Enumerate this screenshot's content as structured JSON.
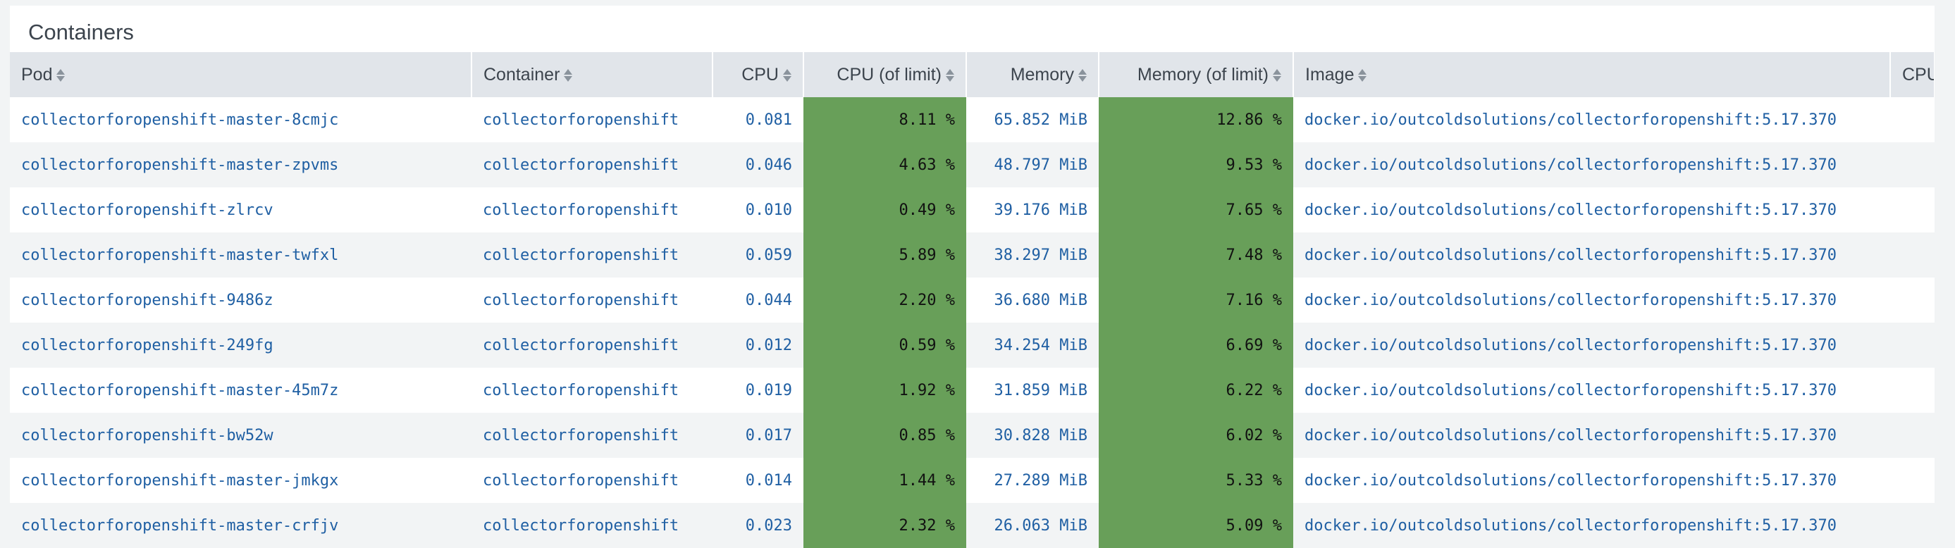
{
  "panel": {
    "title": "Containers"
  },
  "colors": {
    "highlight": "#689f59",
    "link": "#1f5fa3",
    "header_bg": "#e1e5ea"
  },
  "columns": [
    "Pod",
    "Container",
    "CPU",
    "CPU (of limit)",
    "Memory",
    "Memory (of limit)",
    "Image",
    "CPU"
  ],
  "rows": [
    {
      "pod": "collectorforopenshift-master-8cmjc",
      "container": "collectorforopenshift",
      "cpu": "0.081",
      "cpu_limit": "8.11 %",
      "memory": "65.852 MiB",
      "memory_limit": "12.86 %",
      "image": "docker.io/outcoldsolutions/collectorforopenshift:5.17.370"
    },
    {
      "pod": "collectorforopenshift-master-zpvms",
      "container": "collectorforopenshift",
      "cpu": "0.046",
      "cpu_limit": "4.63 %",
      "memory": "48.797 MiB",
      "memory_limit": "9.53 %",
      "image": "docker.io/outcoldsolutions/collectorforopenshift:5.17.370"
    },
    {
      "pod": "collectorforopenshift-zlrcv",
      "container": "collectorforopenshift",
      "cpu": "0.010",
      "cpu_limit": "0.49 %",
      "memory": "39.176 MiB",
      "memory_limit": "7.65 %",
      "image": "docker.io/outcoldsolutions/collectorforopenshift:5.17.370"
    },
    {
      "pod": "collectorforopenshift-master-twfxl",
      "container": "collectorforopenshift",
      "cpu": "0.059",
      "cpu_limit": "5.89 %",
      "memory": "38.297 MiB",
      "memory_limit": "7.48 %",
      "image": "docker.io/outcoldsolutions/collectorforopenshift:5.17.370"
    },
    {
      "pod": "collectorforopenshift-9486z",
      "container": "collectorforopenshift",
      "cpu": "0.044",
      "cpu_limit": "2.20 %",
      "memory": "36.680 MiB",
      "memory_limit": "7.16 %",
      "image": "docker.io/outcoldsolutions/collectorforopenshift:5.17.370"
    },
    {
      "pod": "collectorforopenshift-249fg",
      "container": "collectorforopenshift",
      "cpu": "0.012",
      "cpu_limit": "0.59 %",
      "memory": "34.254 MiB",
      "memory_limit": "6.69 %",
      "image": "docker.io/outcoldsolutions/collectorforopenshift:5.17.370"
    },
    {
      "pod": "collectorforopenshift-master-45m7z",
      "container": "collectorforopenshift",
      "cpu": "0.019",
      "cpu_limit": "1.92 %",
      "memory": "31.859 MiB",
      "memory_limit": "6.22 %",
      "image": "docker.io/outcoldsolutions/collectorforopenshift:5.17.370"
    },
    {
      "pod": "collectorforopenshift-bw52w",
      "container": "collectorforopenshift",
      "cpu": "0.017",
      "cpu_limit": "0.85 %",
      "memory": "30.828 MiB",
      "memory_limit": "6.02 %",
      "image": "docker.io/outcoldsolutions/collectorforopenshift:5.17.370"
    },
    {
      "pod": "collectorforopenshift-master-jmkgx",
      "container": "collectorforopenshift",
      "cpu": "0.014",
      "cpu_limit": "1.44 %",
      "memory": "27.289 MiB",
      "memory_limit": "5.33 %",
      "image": "docker.io/outcoldsolutions/collectorforopenshift:5.17.370"
    },
    {
      "pod": "collectorforopenshift-master-crfjv",
      "container": "collectorforopenshift",
      "cpu": "0.023",
      "cpu_limit": "2.32 %",
      "memory": "26.063 MiB",
      "memory_limit": "5.09 %",
      "image": "docker.io/outcoldsolutions/collectorforopenshift:5.17.370"
    }
  ]
}
